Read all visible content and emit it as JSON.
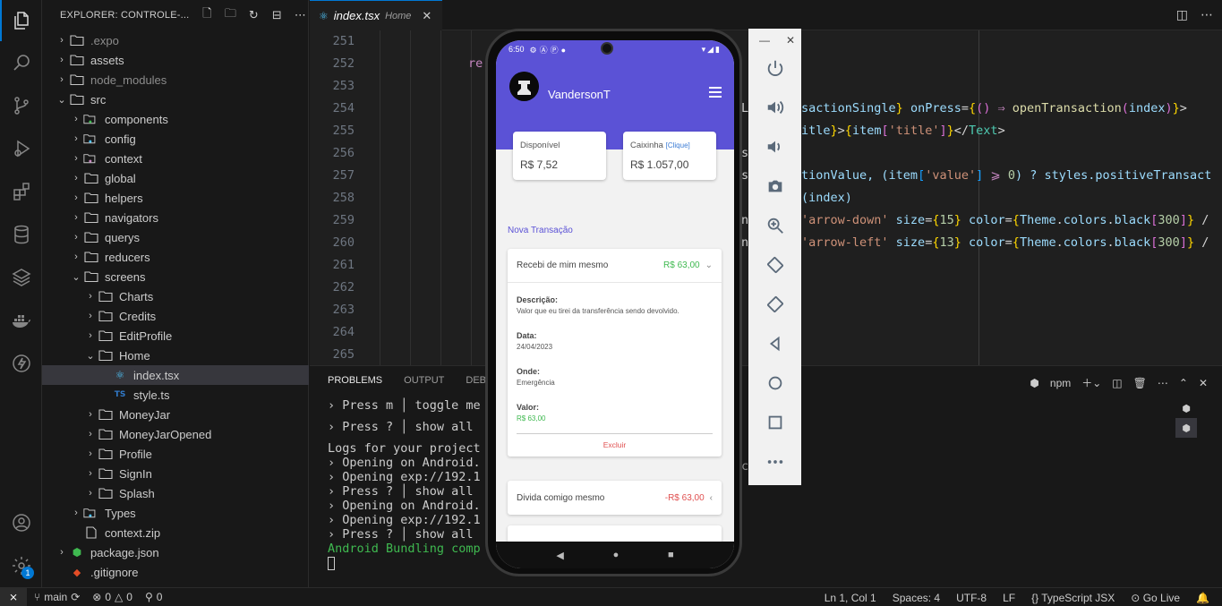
{
  "sidebar": {
    "title": "EXPLORER: CONTROLE-...",
    "items": [
      {
        "label": ".expo",
        "kind": "folder"
      },
      {
        "label": "assets",
        "kind": "folder"
      },
      {
        "label": "node_modules",
        "kind": "folder"
      },
      {
        "label": "src",
        "kind": "folder-open"
      },
      {
        "label": "components",
        "kind": "folder"
      },
      {
        "label": "config",
        "kind": "folder"
      },
      {
        "label": "context",
        "kind": "folder"
      },
      {
        "label": "global",
        "kind": "folder"
      },
      {
        "label": "helpers",
        "kind": "folder"
      },
      {
        "label": "navigators",
        "kind": "folder"
      },
      {
        "label": "querys",
        "kind": "folder"
      },
      {
        "label": "reducers",
        "kind": "folder"
      },
      {
        "label": "screens",
        "kind": "folder-open"
      },
      {
        "label": "Charts",
        "kind": "folder"
      },
      {
        "label": "Credits",
        "kind": "folder"
      },
      {
        "label": "EditProfile",
        "kind": "folder"
      },
      {
        "label": "Home",
        "kind": "folder-open"
      },
      {
        "label": "index.tsx",
        "kind": "react"
      },
      {
        "label": "style.ts",
        "kind": "ts"
      },
      {
        "label": "MoneyJar",
        "kind": "folder"
      },
      {
        "label": "MoneyJarOpened",
        "kind": "folder"
      },
      {
        "label": "Profile",
        "kind": "folder"
      },
      {
        "label": "SignIn",
        "kind": "folder"
      },
      {
        "label": "Splash",
        "kind": "folder"
      },
      {
        "label": "Types",
        "kind": "folder"
      },
      {
        "label": "context.zip",
        "kind": "file"
      },
      {
        "label": "package.json",
        "kind": "json"
      },
      {
        "label": ".gitignore",
        "kind": "git"
      }
    ]
  },
  "tab": {
    "name": "index.tsx",
    "desc": "Home",
    "close": "✕"
  },
  "editor": {
    "line_numbers": [
      "251",
      "252",
      "253",
      "254",
      "255",
      "256",
      "257",
      "258",
      "259",
      "260",
      "261",
      "262",
      "263",
      "264",
      "265"
    ],
    "ret": "re",
    "line254": [
      "sactionSingle",
      "} ",
      "onPress",
      "=",
      "{",
      "() ",
      "⇒",
      " openTransaction",
      "(",
      "index",
      ")",
      "}",
      ">"
    ],
    "line255": [
      "itle",
      "}",
      ">",
      "{",
      "item",
      "[",
      "'title'",
      "]",
      "}",
      "</",
      "Text",
      ">"
    ],
    "line256": "s",
    "line257": [
      "tionValue, (",
      "item",
      "[",
      "'value'",
      "] ",
      "⩾",
      " 0",
      ") ? styles.positiveTransact"
    ],
    "line258": "(index)",
    "line259": [
      "'arrow-down'",
      " size",
      "=",
      "{",
      "15",
      "}",
      " color",
      "=",
      "{",
      "Theme",
      ".",
      "colors",
      ".",
      "black",
      "[",
      "300",
      "]",
      "}",
      " /"
    ],
    "line260": [
      "'arrow-left'",
      " size",
      "=",
      "{",
      "13",
      "}",
      " color",
      "=",
      "{",
      "Theme",
      ".",
      "colors",
      ".",
      "black",
      "[",
      "300",
      "]",
      "}",
      " /"
    ],
    "line_side_chars": [
      "L",
      "s",
      "s",
      "n",
      "n"
    ]
  },
  "panel": {
    "tabs": [
      "PROBLEMS",
      "OUTPUT",
      "DEBU"
    ],
    "shell": "npm",
    "terminal": [
      "› Press m │ toggle me",
      "",
      "› Press ? │ show all",
      "",
      "Logs for your project",
      "› Opening on Android.",
      "› Opening exp://192.1",
      "› Press ? │ show all",
      "› Opening on Android.",
      "› Opening exp://192.1",
      "› Press ? │ show all",
      "Android Bundling comp"
    ],
    "right_char": "c"
  },
  "status": {
    "branch": "main",
    "errors": "0",
    "warnings": "0",
    "ports": "0",
    "position": "Ln 1, Col 1",
    "spaces": "Spaces: 4",
    "encoding": "UTF-8",
    "eol": "LF",
    "language": "TypeScript JSX",
    "golive": "Go Live",
    "settings_badge": "1"
  },
  "phone": {
    "time": "6:50",
    "username": "VandersonT",
    "disponivel_label": "Disponível",
    "disponivel_value": "R$ 7,52",
    "caixinha_label": "Caixinha",
    "caixinha_clique": "[Clique]",
    "caixinha_value": "R$ 1.057,00",
    "nova_transacao": "Nova Transação",
    "tx1": {
      "title": "Recebi de mim mesmo",
      "amount": "R$ 63,00",
      "descricao_label": "Descrição:",
      "descricao": "Valor que eu tirei da transferência sendo devolvido.",
      "data_label": "Data:",
      "data": "24/04/2023",
      "onde_label": "Onde:",
      "onde": "Emergência",
      "valor_label": "Valor:",
      "valor": "R$ 63,00",
      "excluir": "Excluir"
    },
    "tx2": {
      "title": "Divida comigo mesmo",
      "amount": "-R$ 63,00"
    }
  },
  "colors": {
    "accent": "#0078d4",
    "app_purple": "#5b52d6",
    "positive": "#3fb950",
    "negative": "#e05050"
  }
}
